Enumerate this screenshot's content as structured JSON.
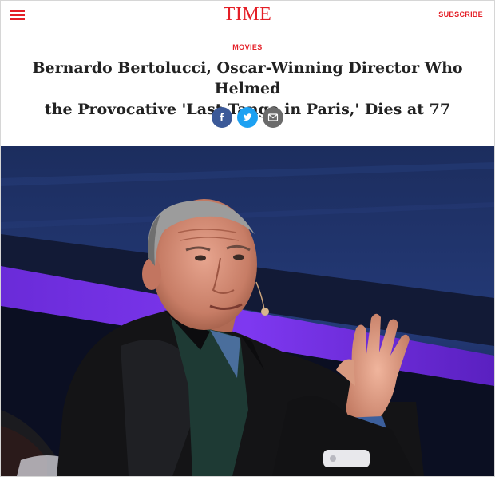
{
  "header": {
    "logo": "TIME",
    "subscribe_label": "SUBSCRIBE",
    "brand_color": "#e41e26"
  },
  "article": {
    "section": "MOVIES",
    "headline_line1": "Bernardo Bertolucci, Oscar-Winning Director Who Helmed",
    "headline_line2": "the Provocative 'Last Tango in Paris,' Dies at 77"
  },
  "share": {
    "buttons": [
      {
        "icon": "facebook-icon",
        "color": "#3b5998"
      },
      {
        "icon": "twitter-icon",
        "color": "#1da1f2"
      },
      {
        "icon": "email-icon",
        "color": "#6b6b6b"
      }
    ]
  },
  "hero": {
    "icon": "photo-of-bernardo-bertolucci"
  }
}
